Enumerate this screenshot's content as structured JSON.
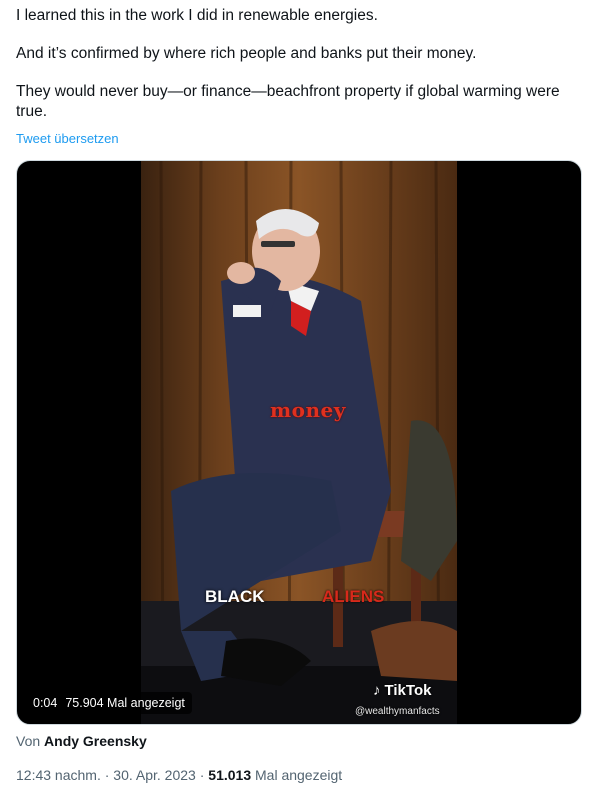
{
  "tweet": {
    "paragraphs": [
      "I learned this in the work I did in renewable energies.",
      "And it’s confirmed by where rich people and banks put their money.",
      "They would never buy—or finance—beachfront property if global warming were true."
    ],
    "translate_link": "Tweet übersetzen"
  },
  "media": {
    "overlay_money": "money",
    "overlay_black": "BLACK",
    "overlay_aliens": "ALIENS",
    "tiktok_label": "TikTok",
    "tiktok_handle": "@wealthymanfacts",
    "duration": "0:04",
    "views": "75.904 Mal angezeigt"
  },
  "attribution": {
    "prefix": "Von",
    "author": "Andy Greensky"
  },
  "meta": {
    "time": "12:43 nachm.",
    "separator1": "·",
    "date": "30. Apr. 2023",
    "separator2": "·",
    "view_count": "51.013",
    "view_label": "Mal angezeigt"
  },
  "colors": {
    "link": "#1d9bf0",
    "secondary_text": "#536471",
    "primary_text": "#0f1419"
  }
}
